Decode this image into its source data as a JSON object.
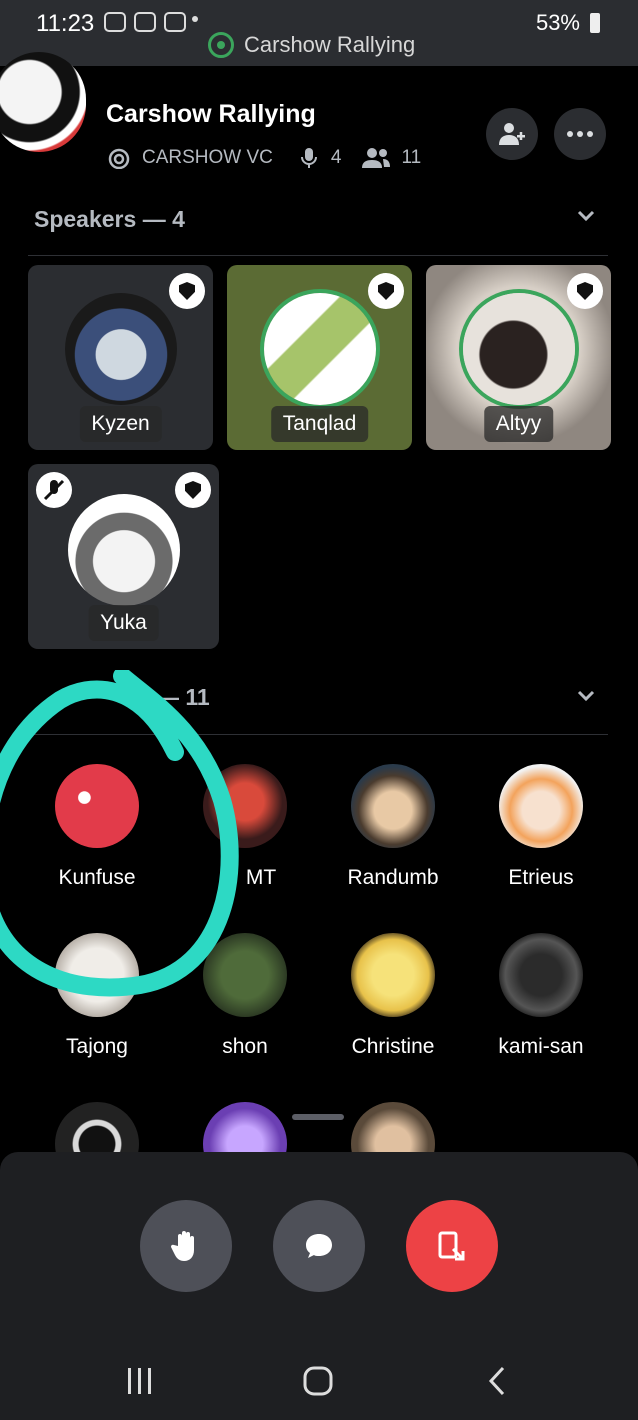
{
  "status_bar": {
    "time": "11:23",
    "battery": "53%",
    "activity": "Carshow Rallying"
  },
  "header": {
    "title": "Carshow Rallying",
    "channel": "CARSHOW VC",
    "speaker_count": "4",
    "listener_count": "11"
  },
  "speakers": {
    "heading": "Speakers — 4",
    "items": [
      {
        "name": "Kyzen"
      },
      {
        "name": "Tanqlad"
      },
      {
        "name": "Altyy"
      },
      {
        "name": "Yuka"
      }
    ]
  },
  "audience": {
    "heading_suffix": "— 11",
    "items": [
      {
        "name": "Kunfuse"
      },
      {
        "name": "MT"
      },
      {
        "name": "Randumb"
      },
      {
        "name": "Etrieus"
      },
      {
        "name": "Tajong"
      },
      {
        "name": "shon"
      },
      {
        "name": "Christine"
      },
      {
        "name": "kami-san"
      }
    ]
  },
  "colors": {
    "accent_green": "#3ba55c",
    "annotation": "#2dd9c4",
    "leave": "#ed4245"
  }
}
